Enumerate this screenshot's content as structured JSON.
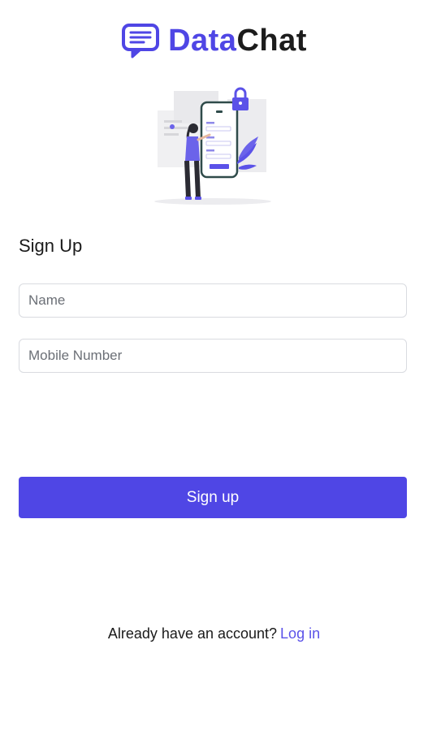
{
  "brand": {
    "name_part_1": "Data",
    "name_part_2": "Chat",
    "icon": "chat-bubble-icon",
    "accent_color": "#4f46e5"
  },
  "illustration": {
    "icon": "signup-illustration"
  },
  "form": {
    "heading": "Sign Up",
    "name_placeholder": "Name",
    "mobile_placeholder": "Mobile Number",
    "submit_label": "Sign up"
  },
  "footer": {
    "prompt": "Already have an account?",
    "login_link": "Log in"
  },
  "colors": {
    "primary": "#4f46e5",
    "link": "#5b52e8",
    "border": "#d9dbe0"
  }
}
